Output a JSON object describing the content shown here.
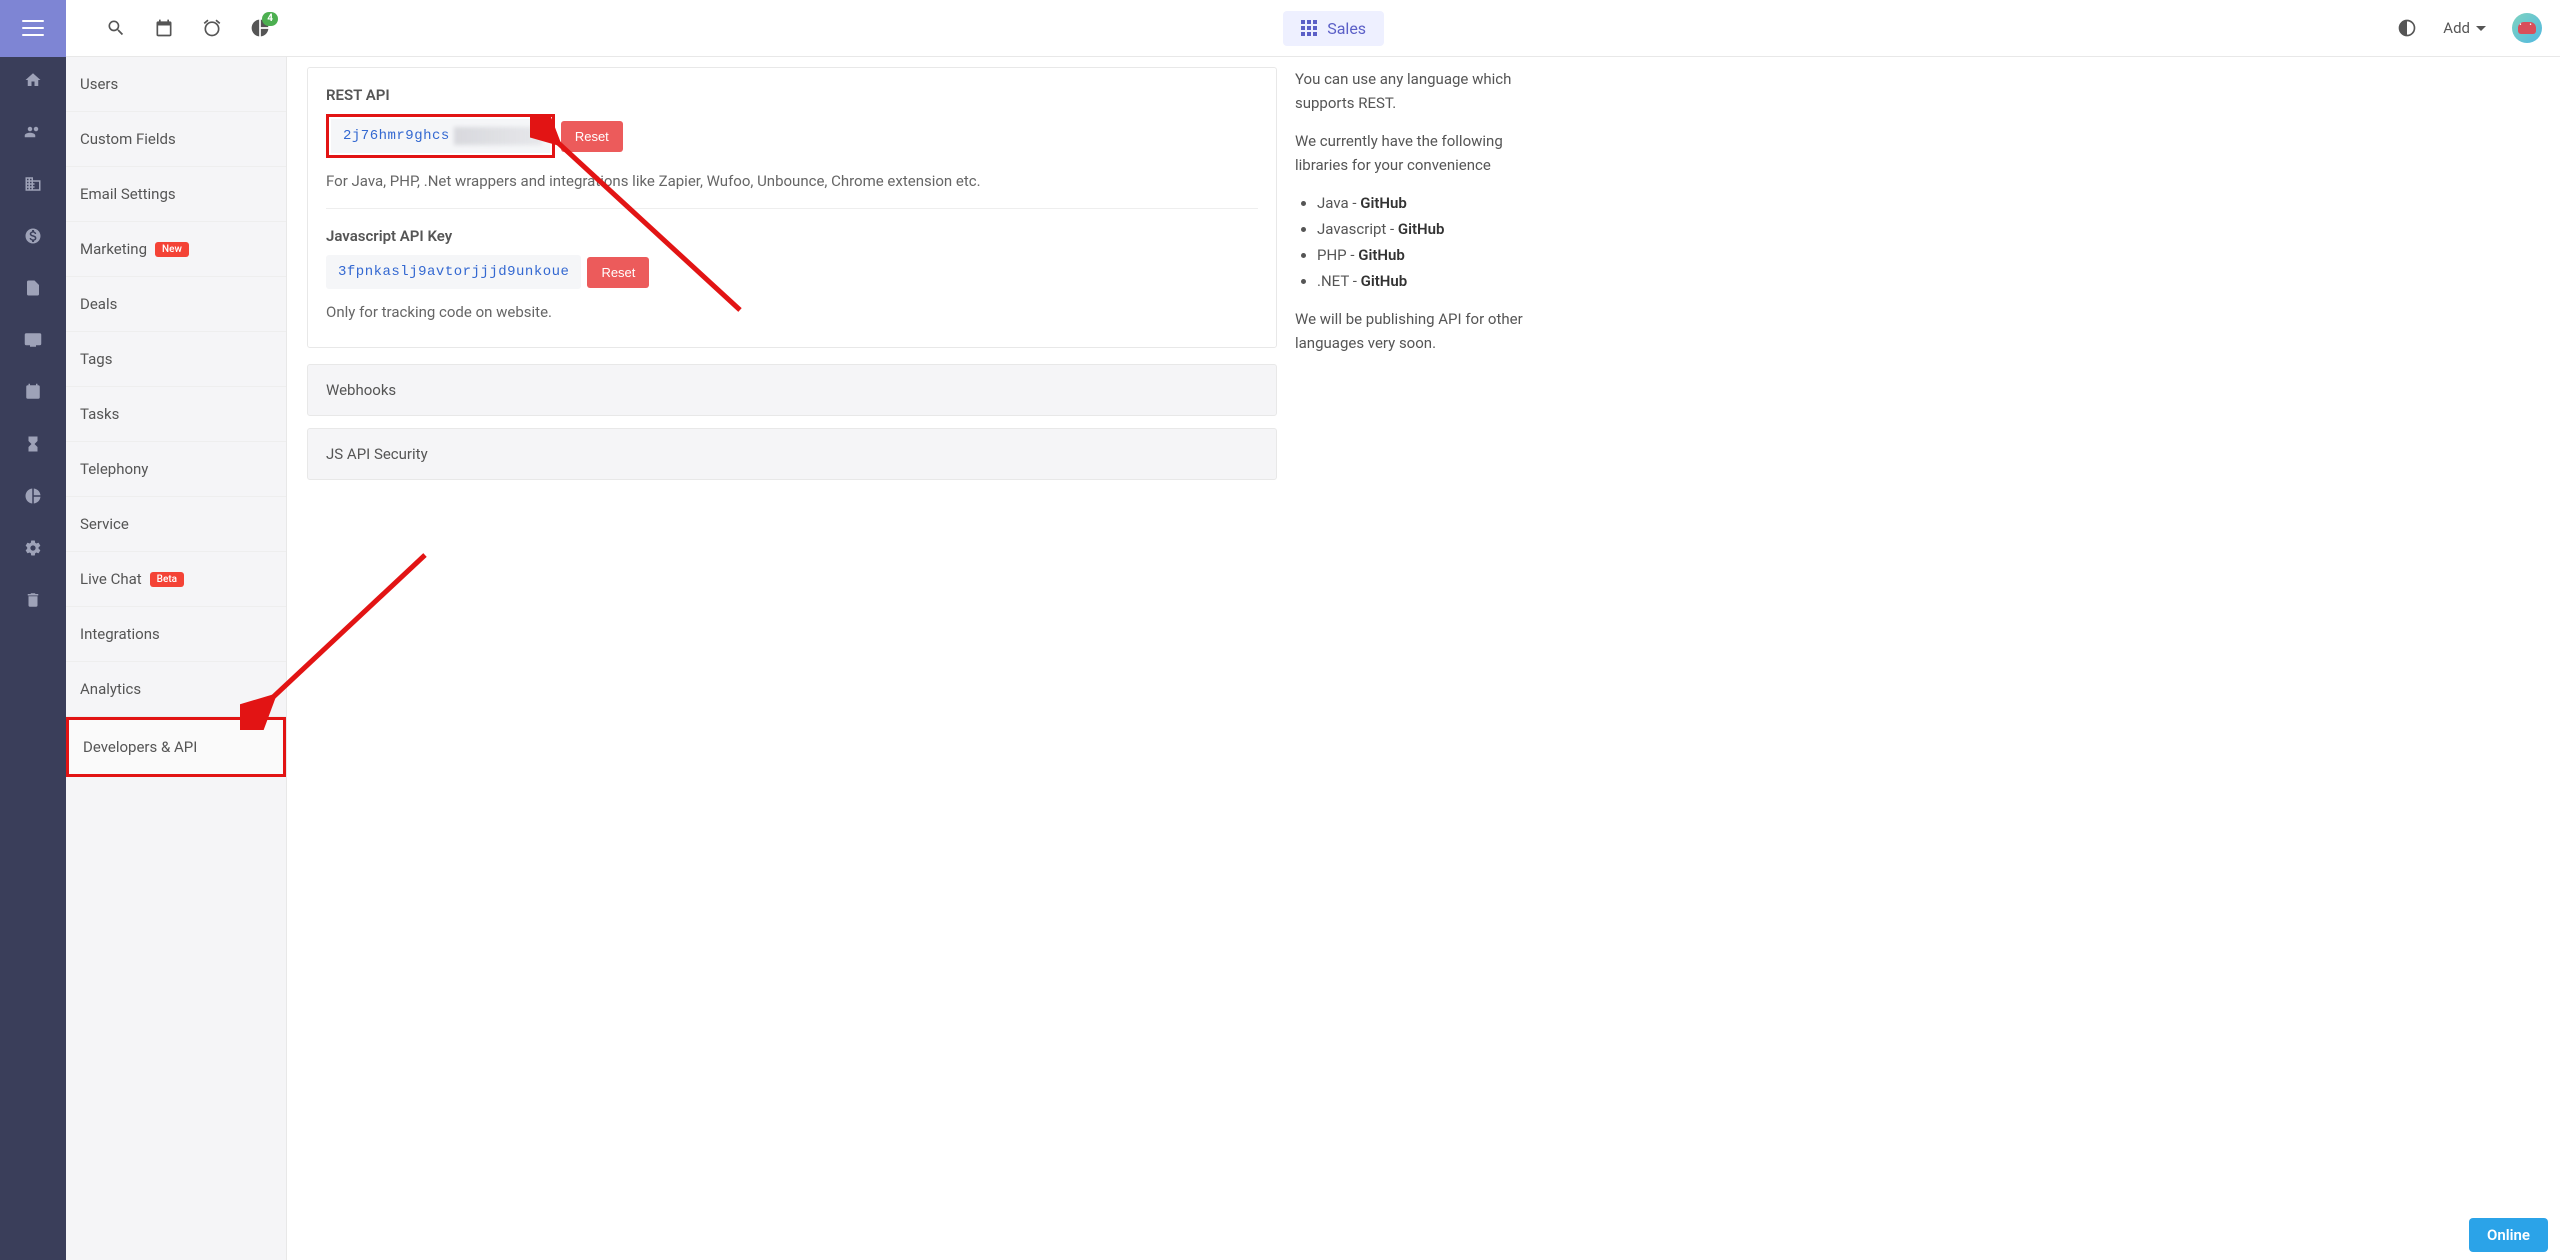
{
  "topbar": {
    "sales_label": "Sales",
    "add_label": "Add",
    "notification_count": "4"
  },
  "sidebar": {
    "items": [
      {
        "label": "Users"
      },
      {
        "label": "Custom Fields"
      },
      {
        "label": "Email Settings"
      },
      {
        "label": "Marketing",
        "badge": "New"
      },
      {
        "label": "Deals"
      },
      {
        "label": "Tags"
      },
      {
        "label": "Tasks"
      },
      {
        "label": "Telephony"
      },
      {
        "label": "Service"
      },
      {
        "label": "Live Chat",
        "badge": "Beta"
      },
      {
        "label": "Integrations"
      },
      {
        "label": "Analytics"
      },
      {
        "label": "Developers & API"
      }
    ]
  },
  "content": {
    "rest_api": {
      "title": "REST API",
      "key": "2j76hmr9ghcs",
      "reset_label": "Reset",
      "description": "For Java, PHP, .Net wrappers and integrations like Zapier, Wufoo, Unbounce, Chrome extension etc."
    },
    "js_api": {
      "title": "Javascript API Key",
      "key": "3fpnkaslj9avtorjjjd9unkoue",
      "reset_label": "Reset",
      "description": "Only for tracking code on website."
    },
    "webhooks_label": "Webhooks",
    "js_security_label": "JS API Security"
  },
  "right_panel": {
    "p1": "You can use any language which supports REST.",
    "p2": "We currently have the following libraries for your convenience",
    "libs": [
      {
        "lang": "Java",
        "sep": " - ",
        "link": "GitHub"
      },
      {
        "lang": "Javascript",
        "sep": " - ",
        "link": "GitHub"
      },
      {
        "lang": "PHP",
        "sep": " - ",
        "link": "GitHub"
      },
      {
        "lang": ".NET",
        "sep": " - ",
        "link": "GitHub"
      }
    ],
    "p3": "We will be publishing API for other languages very soon."
  },
  "online_label": "Online"
}
